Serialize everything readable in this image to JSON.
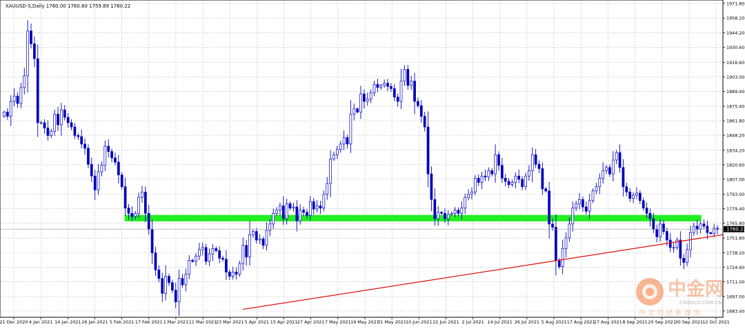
{
  "chart_data": {
    "type": "candlestick",
    "symbol_line": "XAUUSD-S,Daily  1760.00 1760.80 1759.89 1760.22",
    "ylim": [
      1680.0,
      1975.0
    ],
    "y_ticks": [
      "1971.80",
      "1958.20",
      "1944.20",
      "1930.60",
      "1916.60",
      "1903.00",
      "1889.40",
      "1875.40",
      "1861.80",
      "1848.20",
      "1834.20",
      "1820.60",
      "1807.00",
      "1793.00",
      "1779.40",
      "1765.80",
      "1751.80",
      "1738.20",
      "1724.60",
      "1711.00",
      "1697.00",
      "1683.40"
    ],
    "x_ticks": [
      "21 Dec 2020",
      "4 Jan 2021",
      "14 Jan 2021",
      "26 Jan 2021",
      "5 Feb 2021",
      "17 Feb 2021",
      "1 Mar 2021",
      "11 Mar 2021",
      "23 Mar 2021",
      "5 Apr 2021",
      "15 Apr 2021",
      "27 Apr 2021",
      "7 May 2021",
      "19 May 2021",
      "31 May 2021",
      "10 Jun 2021",
      "22 Jun 2021",
      "2 Jul 2021",
      "14 Jul 2021",
      "26 Jul 2021",
      "5 Aug 2021",
      "17 Aug 2021",
      "27 Aug 2021",
      "8 Sep 2021",
      "20 Sep 2021",
      "30 Sep 2021",
      "12 Oct 2021"
    ],
    "current_price_label": "1760.22",
    "current_price": 1760.22,
    "support_band": {
      "from": 1767.5,
      "to": 1773.5,
      "color": "#22ee22"
    },
    "trendline": {
      "from": {
        "date": "24 Mar 2021",
        "price": 1685.0
      },
      "to": {
        "date": "18 Oct 2021",
        "price": 1755.0
      },
      "color": "#dd1111"
    },
    "bull_color": "#ffffff",
    "bear_color": "#0000bb",
    "closes": [
      1870,
      1866,
      1880,
      1885,
      1878,
      1893,
      1904,
      1946,
      1934,
      1920,
      1860,
      1860,
      1855,
      1848,
      1852,
      1868,
      1858,
      1872,
      1865,
      1860,
      1856,
      1848,
      1847,
      1840,
      1836,
      1821,
      1810,
      1797,
      1814,
      1820,
      1838,
      1833,
      1827,
      1823,
      1811,
      1800,
      1780,
      1775,
      1772,
      1775,
      1790,
      1795,
      1775,
      1760,
      1738,
      1722,
      1714,
      1700,
      1716,
      1710,
      1703,
      1692,
      1714,
      1708,
      1718,
      1731,
      1730,
      1735,
      1741,
      1743,
      1730,
      1737,
      1742,
      1740,
      1733,
      1732,
      1720,
      1716,
      1720,
      1718,
      1728,
      1745,
      1734,
      1755,
      1758,
      1750,
      1751,
      1745,
      1759,
      1765,
      1775,
      1778,
      1782,
      1770,
      1784,
      1780,
      1781,
      1768,
      1778,
      1776,
      1773,
      1786,
      1779,
      1782,
      1780,
      1793,
      1803,
      1826,
      1830,
      1835,
      1840,
      1846,
      1840,
      1868,
      1873,
      1870,
      1887,
      1880,
      1882,
      1888,
      1896,
      1893,
      1895,
      1897,
      1894,
      1892,
      1884,
      1880,
      1899,
      1910,
      1895,
      1899,
      1880,
      1876,
      1866,
      1856,
      1812,
      1788,
      1770,
      1776,
      1775,
      1770,
      1774,
      1775,
      1778,
      1775,
      1780,
      1790,
      1793,
      1795,
      1808,
      1804,
      1810,
      1809,
      1815,
      1812,
      1830,
      1820,
      1808,
      1805,
      1802,
      1804,
      1810,
      1807,
      1800,
      1810,
      1815,
      1830,
      1821,
      1817,
      1798,
      1796,
      1765,
      1762,
      1731,
      1725,
      1742,
      1752,
      1765,
      1780,
      1784,
      1788,
      1781,
      1777,
      1787,
      1796,
      1800,
      1808,
      1815,
      1818,
      1812,
      1825,
      1832,
      1818,
      1800,
      1795,
      1789,
      1792,
      1794,
      1787,
      1780,
      1775,
      1770,
      1760,
      1753,
      1765,
      1758,
      1750,
      1743,
      1743,
      1750,
      1733,
      1729,
      1741,
      1757,
      1763,
      1760,
      1765,
      1763,
      1757,
      1756,
      1761,
      1760
    ]
  },
  "watermark": {
    "brand": "中金网",
    "tagline": "中 文 财 经 新 媒 体",
    "domain": "CNGOLD.COM.CN"
  }
}
